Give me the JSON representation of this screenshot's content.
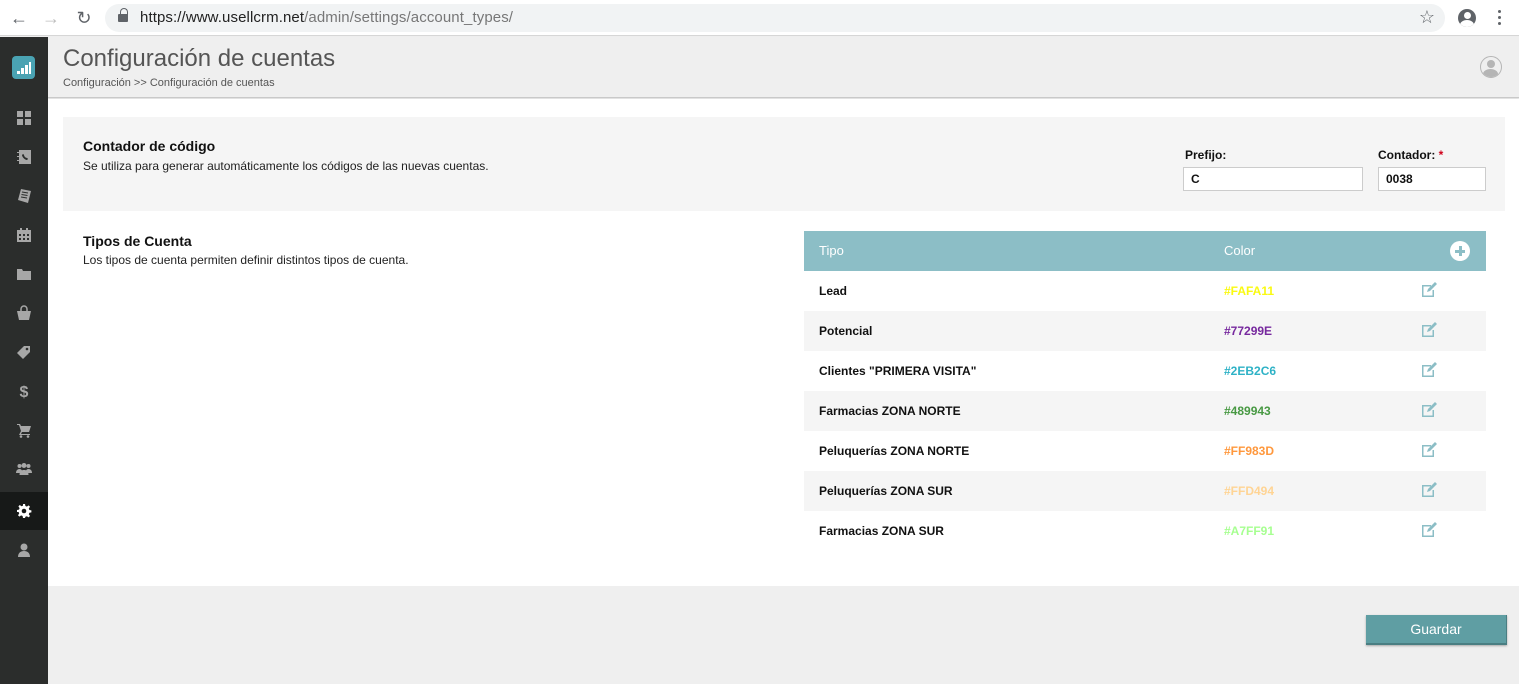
{
  "browser": {
    "url_host": "https://www.usellcrm.net",
    "url_path": "/admin/settings/account_types/"
  },
  "sidebar": {
    "items": [
      {
        "name": "dashboard",
        "icon": "grid-icon",
        "active": false
      },
      {
        "name": "contacts",
        "icon": "address-book-icon",
        "active": false
      },
      {
        "name": "notes",
        "icon": "notepad-icon",
        "active": false
      },
      {
        "name": "calendar",
        "icon": "calendar-icon",
        "active": false
      },
      {
        "name": "files",
        "icon": "folder-icon",
        "active": false
      },
      {
        "name": "shop",
        "icon": "shopping-bag-icon",
        "active": false
      },
      {
        "name": "products",
        "icon": "tag-icon",
        "active": false
      },
      {
        "name": "sales",
        "icon": "dollar-icon",
        "active": false
      },
      {
        "name": "orders",
        "icon": "cart-icon",
        "active": false
      },
      {
        "name": "team",
        "icon": "users-icon",
        "active": false
      },
      {
        "name": "settings",
        "icon": "gear-icon",
        "active": true
      },
      {
        "name": "profile",
        "icon": "user-icon",
        "active": false
      }
    ]
  },
  "header": {
    "title": "Configuración de cuentas",
    "breadcrumb": "Configuración >> Configuración de cuentas"
  },
  "counter": {
    "title": "Contador de código",
    "description": "Se utiliza para generar automáticamente los códigos de las nuevas cuentas.",
    "prefix_label": "Prefijo:",
    "prefix_value": "C",
    "counter_label": "Contador:",
    "counter_required": "*",
    "counter_value": "0038"
  },
  "account_types": {
    "title": "Tipos de Cuenta",
    "description": "Los tipos de cuenta permiten definir distintos tipos de cuenta.",
    "columns": {
      "type": "Tipo",
      "color": "Color"
    },
    "rows": [
      {
        "name": "Lead",
        "color": "#FAFA11"
      },
      {
        "name": "Potencial",
        "color": "#77299E"
      },
      {
        "name": "Clientes \"PRIMERA VISITA\"",
        "color": "#2EB2C6"
      },
      {
        "name": "Farmacias ZONA NORTE",
        "color": "#489943"
      },
      {
        "name": "Peluquerías ZONA NORTE",
        "color": "#FF983D"
      },
      {
        "name": "Peluquerías ZONA SUR",
        "color": "#FFD494"
      },
      {
        "name": "Farmacias ZONA SUR",
        "color": "#A7FF91"
      }
    ]
  },
  "footer": {
    "save_label": "Guardar"
  },
  "colors": {
    "accent": "#8cbec6",
    "button": "#5f9ea3",
    "sidebar": "#2b2d2c",
    "logo": "#4aa3b3"
  }
}
